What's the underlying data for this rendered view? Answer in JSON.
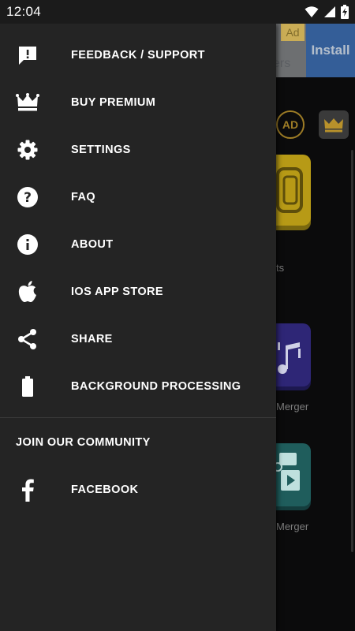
{
  "status_bar": {
    "time": "12:04",
    "icons": [
      "wifi-icon",
      "signal-icon",
      "battery-charging-icon"
    ]
  },
  "drawer": {
    "items": [
      {
        "label": "FEEDBACK / SUPPORT",
        "icon": "feedback-icon"
      },
      {
        "label": "BUY PREMIUM",
        "icon": "crown-icon"
      },
      {
        "label": "SETTINGS",
        "icon": "gear-icon"
      },
      {
        "label": "FAQ",
        "icon": "help-icon"
      },
      {
        "label": "ABOUT",
        "icon": "info-icon"
      },
      {
        "label": "IOS APP STORE",
        "icon": "apple-icon"
      },
      {
        "label": "SHARE",
        "icon": "share-icon"
      },
      {
        "label": "BACKGROUND PROCESSING",
        "icon": "battery-icon"
      }
    ],
    "community": {
      "title": "JOIN OUR COMMUNITY",
      "items": [
        {
          "label": "FACEBOOK",
          "icon": "facebook-icon"
        }
      ]
    }
  },
  "background": {
    "ad": {
      "badge": "Ad",
      "partial_text": "ers",
      "install_label": "Install"
    },
    "no_ads_label": "AD",
    "tile_labels": [
      "ts",
      "Merger",
      "Merger"
    ]
  },
  "colors": {
    "drawer_bg": "#242424",
    "install_blue": "#3a6fb7",
    "gold": "#b8912b"
  }
}
